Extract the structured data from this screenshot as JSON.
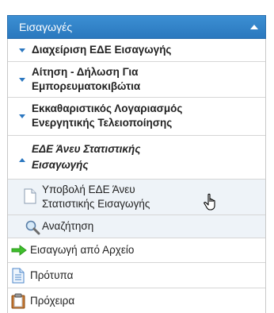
{
  "menu": {
    "header": {
      "label": "Εισαγωγές"
    },
    "items": [
      {
        "label": "Διαχείριση ΕΔΕ Εισαγωγής"
      },
      {
        "label_line1": "Αίτηση - Δήλωση Για",
        "label_line2": "Εμπορευματοκιβώτια"
      },
      {
        "label_line1": "Εκκαθαριστικός Λογαριασμός",
        "label_line2": "Ενεργητικής Τελειοποίησης"
      },
      {
        "label_line1": "ΕΔΕ Άνευ Στατιστικής",
        "label_line2": "Εισαγωγής"
      }
    ],
    "subitems": [
      {
        "label_line1": "Υποβολή ΕΔΕ Άνευ",
        "label_line2": "Στατιστικής Εισαγωγής"
      },
      {
        "label": "Αναζήτηση"
      }
    ],
    "bottom": [
      {
        "label": "Εισαγωγή από Αρχείο"
      },
      {
        "label": "Πρότυπα"
      },
      {
        "label": "Πρόχειρα"
      }
    ]
  },
  "colors": {
    "header": "#2f80c6",
    "accent": "#2b77c0"
  }
}
